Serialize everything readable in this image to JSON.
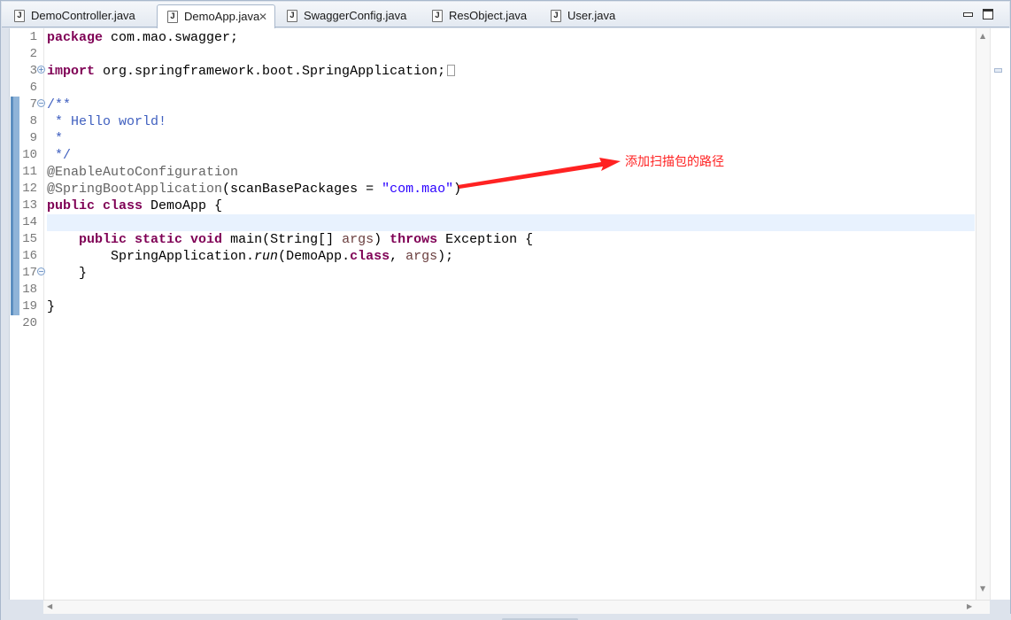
{
  "tabs": [
    {
      "label": "DemoController.java",
      "icon": "java-file-icon"
    },
    {
      "label": "DemoApp.java",
      "icon": "java-file-icon",
      "active": true,
      "close": "✕"
    },
    {
      "label": "SwaggerConfig.java",
      "icon": "java-file-icon"
    },
    {
      "label": "ResObject.java",
      "icon": "java-file-icon"
    },
    {
      "label": "User.java",
      "icon": "java-file-icon"
    }
  ],
  "editor": {
    "line_numbers": [
      "1",
      "2",
      "3",
      "6",
      "7",
      "8",
      "9",
      "10",
      "11",
      "12",
      "13",
      "14",
      "15",
      "16",
      "17",
      "18",
      "19",
      "20"
    ],
    "lines": {
      "l1": {
        "kw": "package",
        "rest": " com.mao.swagger;"
      },
      "l3": {
        "kw": "import",
        "rest": " org.springframework.boot.SpringApplication;"
      },
      "l7": {
        "text": "/**"
      },
      "l8": {
        "text": " * Hello world!"
      },
      "l9": {
        "text": " *"
      },
      "l10": {
        "text": " */"
      },
      "l11": {
        "text": "@EnableAutoConfiguration"
      },
      "l12": {
        "annotation": "@SpringBootApplication",
        "open": "(scanBasePackages = ",
        "string": "\"com.mao\"",
        "close": ")"
      },
      "l13": {
        "kw1": "public",
        "kw2": " class",
        "rest": " DemoApp {"
      },
      "l15": {
        "indent": "    ",
        "kw1": "public",
        "kw2": " static",
        "kw3": " void",
        "mid": " main(String[] ",
        "param": "args",
        "gap": ") ",
        "kw4": "throws",
        "rest": " Exception {"
      },
      "l16": {
        "indent": "        ",
        "call": "SpringApplication.",
        "method": "run",
        "open": "(DemoApp.",
        "kw": "class",
        "comma": ", ",
        "param": "args",
        "close": ");"
      },
      "l17": {
        "text": "    }"
      },
      "l19": {
        "text": "}"
      }
    }
  },
  "annotation": {
    "text": "添加扫描包的路径",
    "color": "#ff2222"
  },
  "colors": {
    "keyword": "#7f0055",
    "comment": "#3f5fbf",
    "annotation": "#646464",
    "string": "#2a00ff",
    "current_line": "#e8f2fe"
  }
}
